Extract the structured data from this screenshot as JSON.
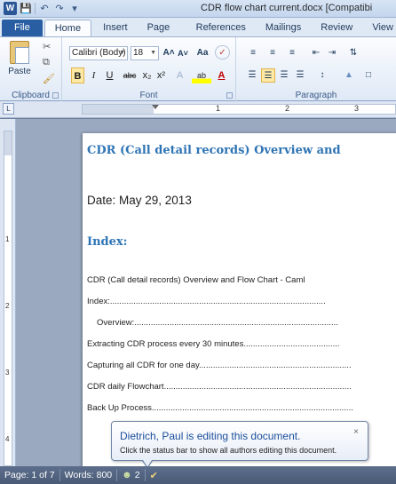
{
  "titlebar": {
    "title": "CDR flow chart current.docx [Compatibi",
    "logo": "W",
    "save_icon": "save-icon",
    "undo_icon": "undo-icon",
    "redo_icon": "redo-icon"
  },
  "tabs": [
    {
      "label": "File"
    },
    {
      "label": "Home"
    },
    {
      "label": "Insert"
    },
    {
      "label": "Page Layout"
    },
    {
      "label": "References"
    },
    {
      "label": "Mailings"
    },
    {
      "label": "Review"
    },
    {
      "label": "View"
    }
  ],
  "ribbon": {
    "clipboard": {
      "paste_label": "Paste",
      "group_label": "Clipboard"
    },
    "font": {
      "font_name": "Calibri (Body)",
      "font_size": "18",
      "group_label": "Font",
      "grow": "A˄",
      "shrink": "A˅",
      "case": "Aa",
      "bold": "B",
      "italic": "I",
      "underline": "U",
      "strike": "abc",
      "subscript": "x₂",
      "superscript": "x²"
    },
    "paragraph": {
      "group_label": "Paragraph"
    }
  },
  "ruler": {
    "marks": [
      "1",
      "2",
      "3"
    ]
  },
  "vruler": {
    "marks": [
      "1",
      "2",
      "3",
      "4"
    ]
  },
  "document": {
    "heading": "CDR (Call detail records) Overview and",
    "date": "Date: May 29, 2013",
    "index_heading": "Index:",
    "toc": [
      "CDR (Call detail records) Overview and Flow Chart - Caml",
      "Index:............................................................................................",
      "Overview:.......................................................................................",
      "Extracting CDR process every 30 minutes.........................................",
      "Capturing all CDR for one day.................................................................",
      "CDR daily Flowchart................................................................................",
      "Back Up Process......................................................................................"
    ]
  },
  "balloon": {
    "title": "Dietrich, Paul is editing this document.",
    "message": "Click the status bar to show all authors editing this document.",
    "close": "×"
  },
  "statusbar": {
    "page": "Page: 1 of 7",
    "words": "Words: 800",
    "authors": "2"
  },
  "colors": {
    "accent": "#2e74b5",
    "file_tab": "#2a5ea3",
    "statusbar": "#4a5b78"
  }
}
